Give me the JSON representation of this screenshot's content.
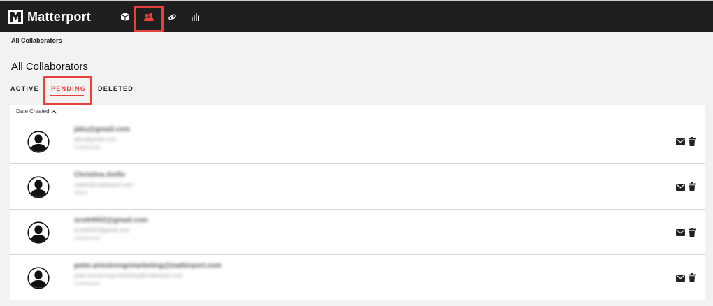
{
  "app": {
    "brand": "Matterport",
    "accent_color": "#e8403a",
    "topbar_color": "#1f1f1f"
  },
  "nav": {
    "icons": [
      "cube-icon",
      "collaborators-icon",
      "link-icon",
      "analytics-icon"
    ],
    "active": "collaborators-icon"
  },
  "breadcrumb": "All Collaborators",
  "page_title": "All Collaborators",
  "tabs": [
    {
      "label": "ACTIVE",
      "active": false
    },
    {
      "label": "PENDING",
      "active": true
    },
    {
      "label": "DELETED",
      "active": false
    }
  ],
  "sort": {
    "label": "Date Created",
    "direction": "ascending"
  },
  "collaborators": [
    {
      "name": "jabu@gmail.com",
      "email": "jabu@gmail.com",
      "role": "Collaborator"
    },
    {
      "name": "Christina Aiello",
      "email": "caiello@matterport.com",
      "role": "Admin"
    },
    {
      "name": "scott4002@gmail.com",
      "email": "scott4002@gmail.com",
      "role": "Collaborator"
    },
    {
      "name": "peter.armstrongrmarketing@matterport.com",
      "email": "peter.armstrongrmarketing@matterport.com",
      "role": "Collaborator"
    }
  ]
}
